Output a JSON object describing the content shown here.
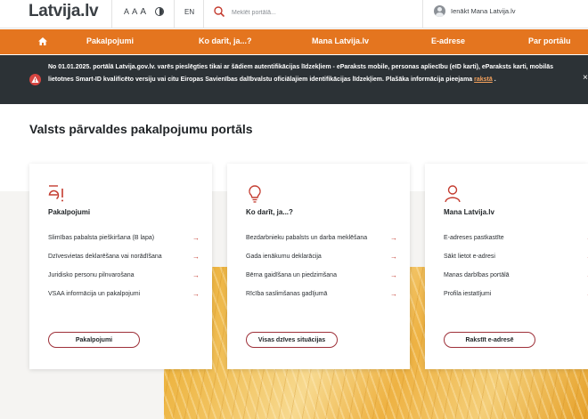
{
  "header": {
    "logo_text": "Latvija.lv",
    "font_sizes": [
      "A",
      "A",
      "A"
    ],
    "language": "EN",
    "search_placeholder": "Meklēt portālā...",
    "login_label": "Ienākt Mana Latvija.lv"
  },
  "nav": {
    "items": [
      "Pakalpojumi",
      "Ko darīt, ja...?",
      "Mana Latvija.lv",
      "E-adrese",
      "Par portālu"
    ]
  },
  "notice": {
    "text": "No 01.01.2025. portālā Latvija.gov.lv. varēs pieslēgties tikai ar šādiem autentifikācijas līdzekļiem - eParaksts mobile, personas apliecību (eID karti), eParaksts karti, mobilās lietotnes Smart-ID kvalificēto versiju vai citu Eiropas Savienības dalībvalstu oficiālajiem identifikācijas līdzekļiem. Plašāka informācija pieejama ",
    "link_text": "rakstā",
    "suffix": " .",
    "close_icon": "close-icon"
  },
  "main": {
    "title": "Valsts pārvaldes pakalpojumu portāls"
  },
  "cards": [
    {
      "title": "Pakalpojumi",
      "icon": "e-exclamation-icon",
      "links": [
        "Slimības pabalsta pieškiršana (B lapa)",
        "Dzīvesvietas deklarēšana vai norādīšana",
        "Juridisko personu pilnvarošana",
        "VSAA informācija un pakalpojumi"
      ],
      "button": "Pakalpojumi"
    },
    {
      "title": "Ko darīt, ja...?",
      "icon": "lightbulb-icon",
      "links": [
        "Bezdarbnieku pabalsts un darba meklēšana",
        "Gada ienākumu deklarācija",
        "Bērna gaidīšana un piedzimšana",
        "Rīcība saslimšanas gadījumā"
      ],
      "button": "Visas dzīves situācijas"
    },
    {
      "title": "Mana Latvija.lv",
      "icon": "user-icon",
      "links": [
        "E-adreses pastkastīte",
        "Sākt lietot e-adresi",
        "Manas darbības portālā",
        "Profila iestatījumi"
      ],
      "button": "Rakstīt e-adresē"
    }
  ],
  "colors": {
    "accent_orange": "#e4751f",
    "brand_red": "#9e3039",
    "notice_bg": "#2c3236"
  }
}
